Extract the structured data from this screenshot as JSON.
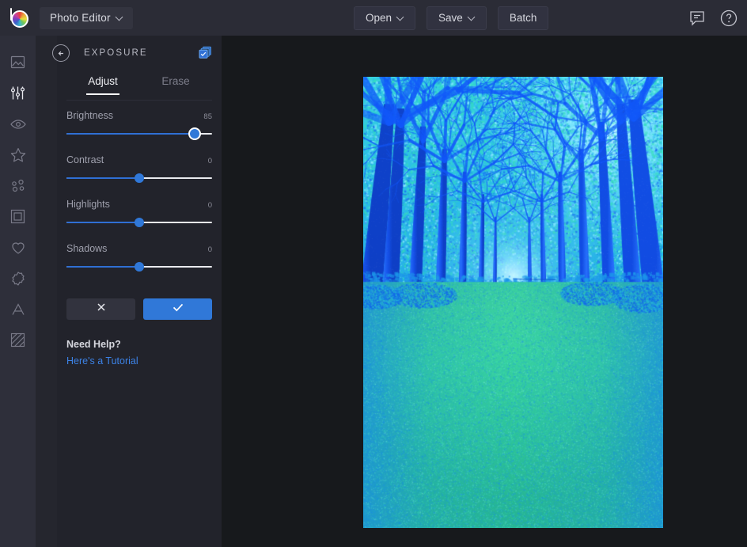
{
  "app": {
    "brand_icon": "befunky-logo-icon",
    "title": "Photo Editor",
    "accent_color": "#3078d8",
    "topbar_bg": "#2b2c36",
    "panel_bg": "#22232b",
    "rail_bg": "#2e2f3a",
    "canvas_bg": "#17191c"
  },
  "topbar": {
    "buttons": [
      {
        "label": "Open",
        "has_chevron": true,
        "name": "open-button"
      },
      {
        "label": "Save",
        "has_chevron": true,
        "name": "save-button"
      },
      {
        "label": "Batch",
        "has_chevron": false,
        "name": "batch-button"
      }
    ],
    "right_icons": [
      {
        "name": "feedback-icon",
        "title": "Feedback"
      },
      {
        "name": "help-icon",
        "title": "Help"
      }
    ]
  },
  "sidebar": {
    "items": [
      {
        "name": "sidebar-item-photo",
        "icon": "image-icon",
        "active": false
      },
      {
        "name": "sidebar-item-edit",
        "icon": "sliders-icon",
        "active": true
      },
      {
        "name": "sidebar-item-touchup",
        "icon": "eye-icon",
        "active": false
      },
      {
        "name": "sidebar-item-effects",
        "icon": "star-icon",
        "active": false
      },
      {
        "name": "sidebar-item-artsy",
        "icon": "dots-icon",
        "active": false
      },
      {
        "name": "sidebar-item-frames",
        "icon": "frame-icon",
        "active": false
      },
      {
        "name": "sidebar-item-overlays",
        "icon": "heart-icon",
        "active": false
      },
      {
        "name": "sidebar-item-textures",
        "icon": "badge-icon",
        "active": false
      },
      {
        "name": "sidebar-item-text",
        "icon": "text-a-icon",
        "active": false
      },
      {
        "name": "sidebar-item-graphics",
        "icon": "stripes-icon",
        "active": false
      }
    ]
  },
  "panel": {
    "back_icon": "back-arrow-icon",
    "title": "EXPOSURE",
    "layers_icon": "compare-layers-icon",
    "tabs": [
      {
        "label": "Adjust",
        "active": true
      },
      {
        "label": "Erase",
        "active": false
      }
    ],
    "sliders": [
      {
        "label": "Brightness",
        "value": "85",
        "percent": 88,
        "active": true
      },
      {
        "label": "Contrast",
        "value": "0",
        "percent": 50,
        "active": false
      },
      {
        "label": "Highlights",
        "value": "0",
        "percent": 50,
        "active": false
      },
      {
        "label": "Shadows",
        "value": "0",
        "percent": 50,
        "active": false
      }
    ],
    "actions": {
      "cancel_icon": "close-x-icon",
      "apply_icon": "checkmark-icon"
    },
    "help": {
      "title": "Need Help?",
      "link": "Here's a Tutorial"
    }
  },
  "canvas": {
    "photo_alt": "tree-lined park avenue with green lawn, blue-cyan tinted"
  }
}
